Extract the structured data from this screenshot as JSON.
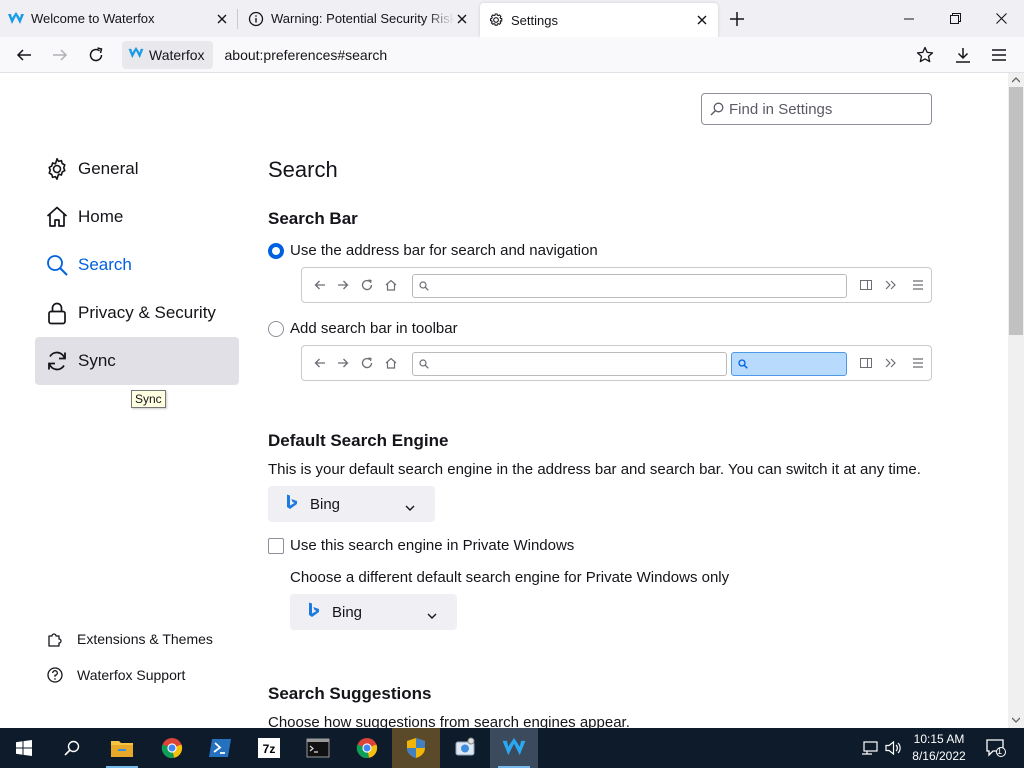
{
  "tabs": [
    {
      "title": "Welcome to Waterfox"
    },
    {
      "title": "Warning: Potential Security Risk Ahead"
    },
    {
      "title": "Settings"
    }
  ],
  "navbar": {
    "identity_label": "Waterfox",
    "url": "about:preferences#search"
  },
  "find": {
    "placeholder": "Find in Settings"
  },
  "sidebar": {
    "items": [
      {
        "label": "General",
        "icon": "gear-icon"
      },
      {
        "label": "Home",
        "icon": "home-icon"
      },
      {
        "label": "Search",
        "icon": "search-icon"
      },
      {
        "label": "Privacy & Security",
        "icon": "lock-icon"
      },
      {
        "label": "Sync",
        "icon": "sync-icon"
      }
    ],
    "tooltip": "Sync",
    "footer": [
      {
        "label": "Extensions & Themes",
        "icon": "puzzle-icon"
      },
      {
        "label": "Waterfox Support",
        "icon": "help-icon"
      }
    ]
  },
  "main": {
    "page_title": "Search",
    "search_bar": {
      "heading": "Search Bar",
      "option_address": "Use the address bar for search and navigation",
      "option_toolbar": "Add search bar in toolbar",
      "selected": "address"
    },
    "default_engine": {
      "heading": "Default Search Engine",
      "description": "This is your default search engine in the address bar and search bar. You can switch it at any time.",
      "engine": "Bing",
      "private_checkbox_label": "Use this search engine in Private Windows",
      "private_checked": false,
      "private_description": "Choose a different default search engine for Private Windows only",
      "private_engine": "Bing"
    },
    "suggestions": {
      "heading": "Search Suggestions",
      "description": "Choose how suggestions from search engines appear."
    }
  },
  "taskbar": {
    "time": "10:15 AM",
    "date": "8/16/2022",
    "notification_count": "1"
  },
  "colors": {
    "accent": "#0061e0",
    "tabstrip": "#f0f0f4",
    "taskbar": "#0d1b2a"
  }
}
